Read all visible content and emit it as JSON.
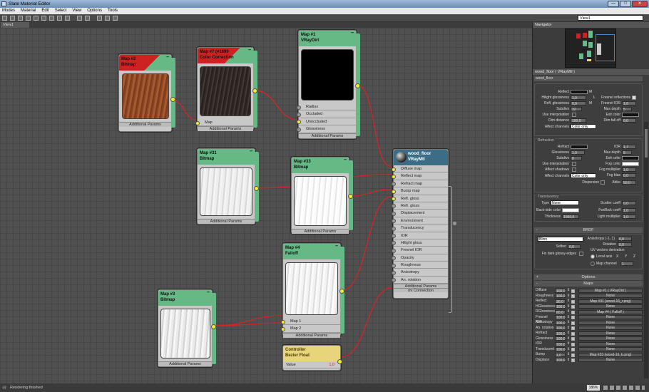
{
  "window": {
    "title": "Slate Material Editor",
    "buttons": [
      "—",
      "□",
      "✕"
    ]
  },
  "menu": [
    "Modes",
    "Material",
    "Edit",
    "Select",
    "View",
    "Options",
    "Tools"
  ],
  "toolbar": {
    "view_select": "View1"
  },
  "tab": {
    "label": "View1"
  },
  "status": {
    "text": "Rendering finished",
    "zoom": "186%"
  },
  "navigator": {
    "title": "Navigator"
  },
  "nodes": {
    "map2": {
      "title1": "Map #2",
      "title2": "Bitmap",
      "footer": "Additional Params"
    },
    "map7": {
      "title1": "Map #7 (#1890",
      "title2": "Color Correction",
      "slot": "Map",
      "footer": "Additional Params"
    },
    "map1": {
      "title1": "Map #1",
      "title2": "VRayDirt",
      "slots": [
        "Radius",
        "Occluded",
        "Unoccluded",
        "Glossiness"
      ],
      "footer": "Additional Params"
    },
    "map31": {
      "title1": "Map #31",
      "title2": "Bitmap",
      "footer": "Additional Params"
    },
    "map33": {
      "title1": "Map #33",
      "title2": "Bitmap",
      "footer": "Additional Params"
    },
    "map4": {
      "title1": "Map #4",
      "title2": "Falloff",
      "slots": [
        "Map 1",
        "Map 2"
      ],
      "footer": "Additional Params"
    },
    "map3": {
      "title1": "Map #3",
      "title2": "Bitmap",
      "footer": "Additional Params"
    },
    "ctrl": {
      "title1": "Controller",
      "title2": "Bezier Float",
      "slot": "Value",
      "value": "1,0"
    },
    "mtl": {
      "title1": "wood_floor",
      "title2": "VRayMtl",
      "slots": [
        "Diffuse map",
        "Reflect map",
        "Refract map",
        "Bump map",
        "Refl. gloss",
        "Refr. gloss",
        "Displacement",
        "Environment",
        "Translucency",
        "IOR",
        "Hilight gloss",
        "Fresnel IOR",
        "Opacity",
        "Roughness",
        "Anisotropy",
        "An. rotation",
        "Additional Params",
        "mr Connection"
      ]
    }
  },
  "props": {
    "title": "wood_floor  ( VRayMtl )",
    "name": "wood_floor",
    "reflection": {
      "reflect": "Reflect",
      "m": "M",
      "hilight_gloss": "Hilight glossiness",
      "hilight_val": "1,0",
      "l": "L",
      "refl_gloss": "Refl. glossiness",
      "refl_val": "0,9",
      "subdivs": "Subdivs",
      "subdivs_val": "32",
      "use_interp": "Use interpolation",
      "dim_dist": "Dim distance",
      "dim_val": "100,0",
      "affect_ch": "Affect channels",
      "affect_val": "Color only",
      "fresnel": "Fresnel reflections",
      "fresnel_ior": "Fresnel IOR",
      "fresnel_ior_val": "1,6",
      "max_depth": "Max depth",
      "max_depth_val": "5",
      "exit_color": "Exit color",
      "dim_falloff": "Dim fall off",
      "dim_falloff_val": "0,0"
    },
    "refraction": {
      "title": "Refraction",
      "refract": "Refract",
      "glossiness": "Glossiness",
      "gloss_val": "1,0",
      "subdivs": "Subdivs",
      "subdivs_val": "8",
      "use_interp": "Use interpolation",
      "affect_shadows": "Affect shadows",
      "affect_ch": "Affect channels",
      "affect_val": "Color only",
      "dispersion": "Dispersion",
      "ior": "IOR",
      "ior_val": "1,7",
      "max_depth": "Max depth",
      "max_depth_val": "5",
      "exit_color": "Exit color",
      "fog_color": "Fog color",
      "fog_mult": "Fog multiplier",
      "fog_mult_val": "1,0",
      "fog_bias": "Fog bias",
      "fog_bias_val": "0,0",
      "abbe": "Abbe",
      "abbe_val": "50,0"
    },
    "translucency": {
      "title": "Translucency",
      "type": "Type",
      "type_val": "None",
      "back_color": "Back-side color",
      "thickness": "Thickness",
      "thickness_val": "1000,0",
      "scatter": "Scatter coeff",
      "scatter_val": "0,0",
      "fwd_bck": "Fwd/bck coeff",
      "fwd_bck_val": "1,0",
      "light_mult": "Light multiplier",
      "light_mult_val": "1,0"
    },
    "brdf": {
      "title": "BRDF",
      "type": "Blinn",
      "anisotropy": "Anisotropy (-1..1)",
      "aniso_val": "0,0",
      "rotation": "Rotation",
      "rotation_val": "0,0",
      "soften": "Soften",
      "soften_val": "0,0",
      "fix_dark": "Fix dark glossy edges",
      "uv": "UV vectors derivation",
      "local_axis": "Local axis",
      "x": "X",
      "y": "Y",
      "z": "Z",
      "map_channel": "Map channel",
      "map_channel_val": "1"
    },
    "options_bar": "Options",
    "maps_bar": "Maps",
    "maps": [
      {
        "name": "Diffuse",
        "amount": "100,0",
        "map": "Map #1 ( VRayDirt )"
      },
      {
        "name": "Roughness",
        "amount": "100,0",
        "map": "None"
      },
      {
        "name": "Reflect",
        "amount": "30,0",
        "map": "Map #31 (wood-16_r.png)"
      },
      {
        "name": "HGlossiness",
        "amount": "100,0",
        "map": "None"
      },
      {
        "name": "RGlossiness",
        "amount": "80,0",
        "map": "Map #4 ( Falloff )"
      },
      {
        "name": "Fresnel IOR",
        "amount": "100,0",
        "map": "None"
      },
      {
        "name": "Anisotropy",
        "amount": "100,0",
        "map": "None"
      },
      {
        "name": "An. rotation",
        "amount": "100,0",
        "map": "None"
      },
      {
        "name": "Refract",
        "amount": "100,0",
        "map": "None"
      },
      {
        "name": "Glossiness",
        "amount": "100,0",
        "map": "None"
      },
      {
        "name": "IOR",
        "amount": "100,0",
        "map": "None"
      },
      {
        "name": "Translucent",
        "amount": "100,0",
        "map": "None"
      },
      {
        "name": "Bump",
        "amount": "1,0",
        "map": "Map #33 (wood-16_b.png)"
      },
      {
        "name": "Displace",
        "amount": "100,0",
        "map": "None"
      }
    ]
  },
  "colors": {
    "accent": "#66b884",
    "wire": "#d22",
    "socket": "#ee3",
    "material_head": "#3b6e86",
    "controller_head": "#e8d47a"
  },
  "icons": [
    "app-icon",
    "minimize-icon",
    "maximize-icon",
    "close-icon",
    "binoculars-icon",
    "material-sphere-icon"
  ]
}
